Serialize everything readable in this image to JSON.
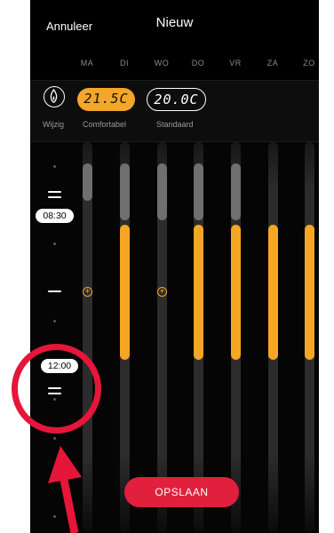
{
  "header": {
    "cancel_label": "Annuleer",
    "title": "Nieuw"
  },
  "days": [
    "MA",
    "DI",
    "WO",
    "DO",
    "VR",
    "ZA",
    "ZO"
  ],
  "modes": {
    "edit_label": "Wijzig",
    "comfort": {
      "value": "21.5C",
      "label": "Comfortabel"
    },
    "standard": {
      "value": "20.0C",
      "label": "Standaard"
    }
  },
  "timeline": {
    "start_label": "08:30",
    "end_label": "12:00"
  },
  "save_label": "OPSLAAN",
  "colors": {
    "accent": "#f5a623",
    "save": "#e0203d",
    "annotation": "#e5163a"
  }
}
